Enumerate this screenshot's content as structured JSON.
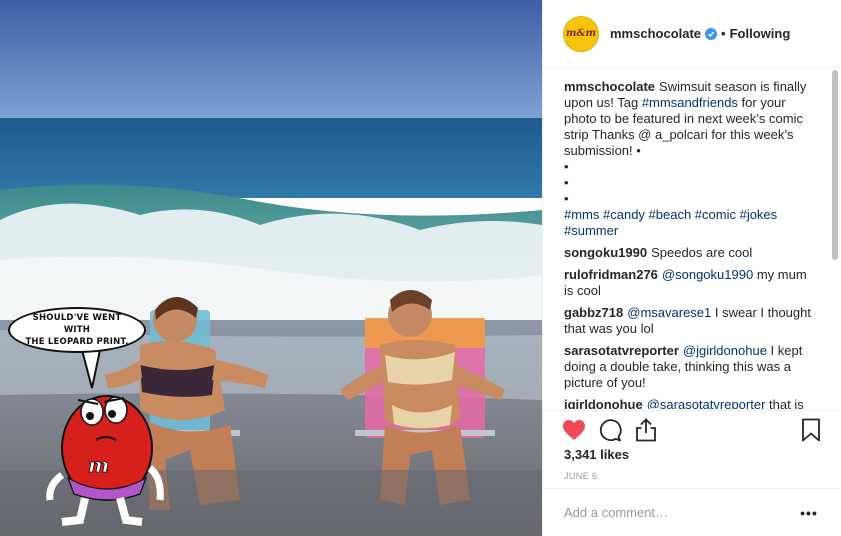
{
  "photo": {
    "speech_bubble": "SHOULD'VE WENT WITH\nTHE LEOPARD PRINT."
  },
  "header": {
    "avatar_text": "m&m",
    "username": "mmschocolate",
    "separator": "•",
    "follow_status": "Following"
  },
  "caption": {
    "username": "mmschocolate",
    "text_before": "Swimsuit season is finally upon us! Tag ",
    "hashtag": "#mmsandfriends",
    "text_after": " for your photo to be featured in next week’s comic strip Thanks @ a_polcari for this week’s submission! •",
    "bullets": "•\n•\n•",
    "tags": "#mms #candy #beach #comic #jokes #summer"
  },
  "comments": [
    {
      "user": "songoku1990",
      "mention": "",
      "text": "Speedos are cool"
    },
    {
      "user": "rulofridman276",
      "mention": "@songoku1990",
      "text": " my mum is cool"
    },
    {
      "user": "gabbz718",
      "mention": "@msavarese1",
      "text": " I swear I thought that was you lol"
    },
    {
      "user": "sarasotatvreporter",
      "mention": "@jgirldonohue",
      "text": " I kept doing a double take, thinking this was a picture of you!"
    },
    {
      "user": "jgirldonohue",
      "mention": "@sarasotatvreporter",
      "text": " that is"
    }
  ],
  "actions": {
    "like_icon": "heart-icon",
    "comment_icon": "comment-icon",
    "share_icon": "share-icon",
    "save_icon": "bookmark-icon",
    "like_color": "#ed4956"
  },
  "likes": "3,341 likes",
  "date": "JUNE 6",
  "add_comment": {
    "placeholder": "Add a comment…",
    "more_label": "•••"
  }
}
